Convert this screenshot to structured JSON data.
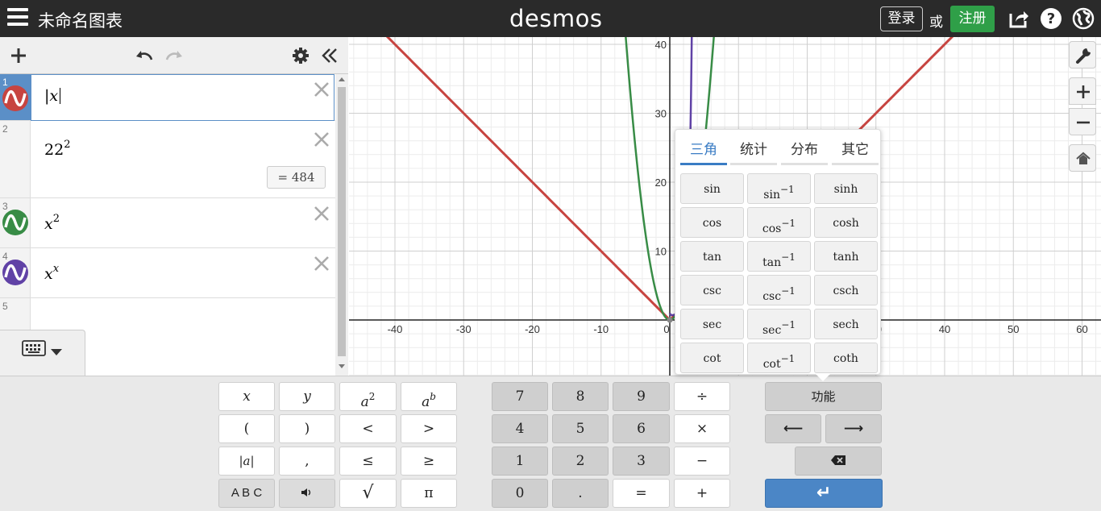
{
  "header": {
    "title": "未命名图表",
    "brand": "desmos",
    "login": "登录",
    "or": "或",
    "signup": "注册",
    "colors": {
      "bar": "#2a2a2a",
      "signup": "#2f9f48"
    }
  },
  "expressions": [
    {
      "num": "1",
      "latex": "|x",
      "color": "#c74440"
    },
    {
      "num": "2",
      "base": "22",
      "exp": "2",
      "result": "=  484"
    },
    {
      "num": "3",
      "base": "x",
      "exp": "2",
      "color": "#388c46"
    },
    {
      "num": "4",
      "base": "x",
      "exp": "x",
      "color": "#6042a6"
    },
    {
      "num": "5"
    }
  ],
  "graph": {
    "x_ticks": [
      "-40",
      "-30",
      "-20",
      "-10",
      "0",
      "30",
      "40",
      "50",
      "60"
    ],
    "y_ticks": [
      "10",
      "20",
      "30",
      "40"
    ],
    "series_colors": {
      "abs": "#c74440",
      "square": "#388c46",
      "power": "#6042a6"
    }
  },
  "func_popup": {
    "tabs": [
      "三角",
      "统计",
      "分布",
      "其它"
    ],
    "active_tab": "三角",
    "rows": [
      [
        "sin",
        "sin",
        "sinh"
      ],
      [
        "cos",
        "cos",
        "cosh"
      ],
      [
        "tan",
        "tan",
        "tanh"
      ],
      [
        "csc",
        "csc",
        "csch"
      ],
      [
        "sec",
        "sec",
        "sech"
      ],
      [
        "cot",
        "cot",
        "coth"
      ]
    ],
    "inverse_exp": "−1"
  },
  "keypad": {
    "col1": [
      "x",
      "y",
      "a",
      "a",
      "(",
      ")",
      "<",
      ">",
      "|a|",
      ",",
      "≤",
      "≥",
      "A B C",
      "",
      "√",
      "π"
    ],
    "sq_exp": "2",
    "b_exp": "b",
    "numpad": [
      "7",
      "8",
      "9",
      "÷",
      "4",
      "5",
      "6",
      "×",
      "1",
      "2",
      "3",
      "−",
      "0",
      ".",
      "=",
      "+"
    ],
    "func_label": "功能",
    "left_arrow": "⟵",
    "right_arrow": "⟶",
    "enter": "↵"
  }
}
